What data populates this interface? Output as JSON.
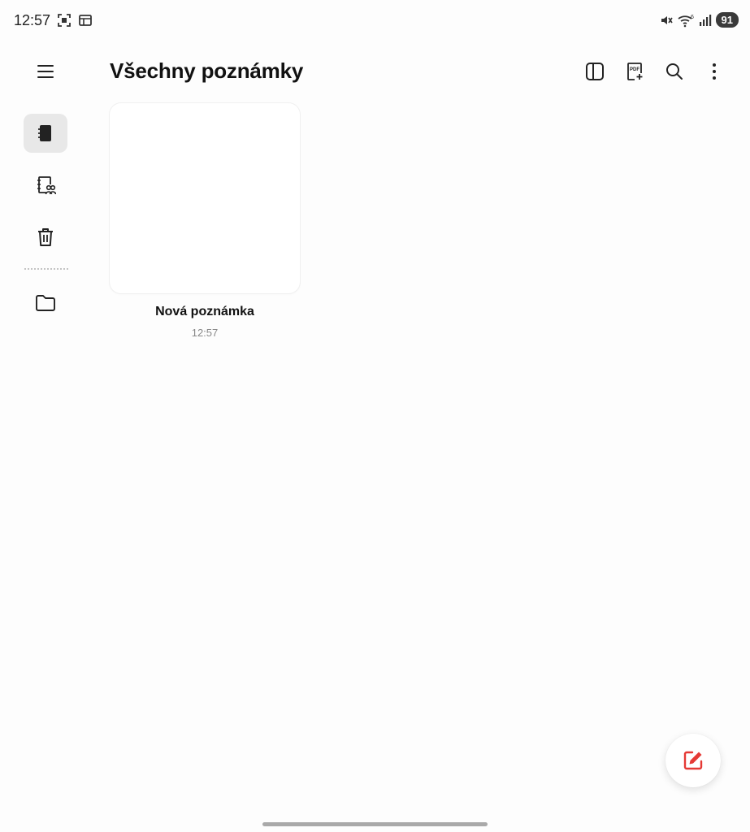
{
  "status_bar": {
    "time": "12:57",
    "battery": "91",
    "icons": [
      "screenshot-icon",
      "calendar-icon",
      "mute-icon",
      "wifi-icon",
      "signal-icon"
    ]
  },
  "header": {
    "title": "Všechny poznámky",
    "menu_icon": "menu-icon",
    "toolbar": [
      "split-view-icon",
      "pdf-add-icon",
      "search-icon",
      "more-vert-icon"
    ]
  },
  "sidebar": {
    "items": [
      {
        "icon": "notebook-icon",
        "active": true
      },
      {
        "icon": "shared-notebook-icon",
        "active": false
      },
      {
        "icon": "trash-icon",
        "active": false
      },
      {
        "icon": "folder-icon",
        "active": false
      }
    ]
  },
  "notes": [
    {
      "title": "Nová poznámka",
      "time": "12:57"
    }
  ],
  "fab": {
    "icon": "new-note-icon"
  },
  "colors": {
    "accent": "#e53935",
    "active_bg": "#e8e8e8",
    "background": "#fdfdfd"
  }
}
